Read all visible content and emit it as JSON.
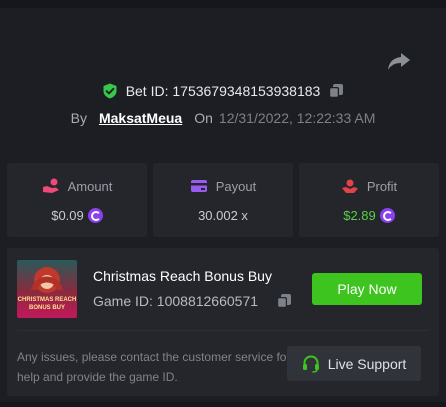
{
  "bet": {
    "id_label": "Bet ID: 1753679348153938183",
    "by_label": "By",
    "username": "MaksatMeua",
    "on_label": "On",
    "date": "12/31/2022, 12:22:33 AM"
  },
  "stats": {
    "amount": {
      "label": "Amount",
      "value": "$0.09"
    },
    "payout": {
      "label": "Payout",
      "value": "30.002 x"
    },
    "profit": {
      "label": "Profit",
      "value": "$2.89"
    }
  },
  "game": {
    "title": "Christmas Reach Bonus Buy",
    "id_label": "Game ID: 1008812660571",
    "thumb_text_line1": "CHRISTMAS REACH",
    "thumb_text_line2": "BONUS BUY",
    "play_label": "Play Now"
  },
  "help": {
    "text": "Any issues, please contact the customer service for help and provide the game ID.",
    "support_label": "Live Support"
  },
  "colors": {
    "accent_green": "#3ec41f",
    "profit_green": "#56d144",
    "coin_purple": "#8a3ff0",
    "shield_green": "#37c84a"
  }
}
